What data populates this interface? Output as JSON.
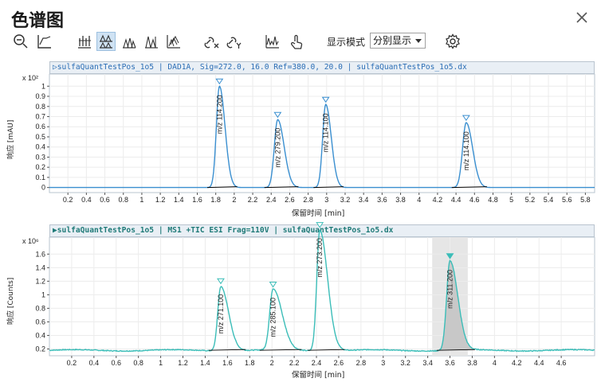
{
  "window": {
    "title": "色谱图"
  },
  "toolbar": {
    "icons": [
      "zoom-icon",
      "baseline-icon",
      "overlay-icon",
      "stack-icon",
      "separate-icon",
      "lines-icon",
      "stair-icon",
      "link-x-icon",
      "link-y-icon",
      "peaks-icon",
      "touch-icon"
    ],
    "mode_label": "显示模式",
    "mode_value": "分别显示",
    "settings_icon": "gear-icon"
  },
  "chart_data": [
    {
      "type": "line",
      "header": "▷sulfaQuantTestPos_1o5 | DAD1A, Sig=272.0, 16.0 Ref=380.0, 20.0 | sulfaQuantTestPos_1o5.dx",
      "ylabel": "响应 [mAU]",
      "xlabel": "保留时间 [min]",
      "y_multiplier": "x 10²",
      "xlim": [
        0,
        5.9
      ],
      "ylim": [
        -0.05,
        1.12
      ],
      "xticks": [
        0.2,
        0.4,
        0.6,
        0.8,
        1,
        1.2,
        1.4,
        1.6,
        1.8,
        2,
        2.2,
        2.4,
        2.6,
        2.8,
        3,
        3.2,
        3.4,
        3.6,
        3.8,
        4,
        4.2,
        4.4,
        4.6,
        4.8,
        5,
        5.2,
        5.4,
        5.6,
        5.8
      ],
      "xtick_labels": [
        "0.2",
        "0.4",
        "0.6",
        "0.8",
        "1",
        "1.2",
        "1.4",
        "1.6",
        "1.8",
        "2",
        "2.2",
        "2.4",
        "2.6",
        "2.8",
        "3",
        "3.2",
        "3.4",
        "3.6",
        "3.8",
        "4",
        "4.2",
        "4.4",
        "4.6",
        "4.8",
        "5",
        "5.2",
        "5.4",
        "5.6",
        "5.8"
      ],
      "yticks": [
        0,
        0.1,
        0.2,
        0.3,
        0.4,
        0.5,
        0.6,
        0.7,
        0.8,
        0.9,
        1
      ],
      "ytick_labels": [
        "0",
        "0.1",
        "0.2",
        "0.3",
        "0.4",
        "0.5",
        "0.6",
        "0.7",
        "0.8",
        "0.9",
        "1"
      ],
      "line_color": "#3a8fd0",
      "peaks": [
        {
          "label": "m/z 114.200",
          "rt": 1.84,
          "height": 1.0,
          "width": 0.055,
          "tail": 0.06
        },
        {
          "label": "m/z 279.200",
          "rt": 2.47,
          "height": 0.67,
          "width": 0.06,
          "tail": 0.07
        },
        {
          "label": "m/z 114.100",
          "rt": 2.99,
          "height": 0.82,
          "width": 0.055,
          "tail": 0.06
        },
        {
          "label": "m/z 114.100",
          "rt": 4.51,
          "height": 0.64,
          "width": 0.065,
          "tail": 0.07
        }
      ]
    },
    {
      "type": "line",
      "header": "▶sulfaQuantTestPos_1o5 | MS1 +TIC ESI Frag=110V | sulfaQuantTestPos_1o5.dx",
      "ylabel": "响应 [Counts]",
      "xlabel": "保留时间 [min]",
      "y_multiplier": "x 10⁶",
      "xlim": [
        0,
        4.9
      ],
      "ylim": [
        0.1,
        1.85
      ],
      "xticks": [
        0.2,
        0.4,
        0.6,
        0.8,
        1,
        1.2,
        1.4,
        1.6,
        1.8,
        2,
        2.2,
        2.4,
        2.6,
        2.8,
        3,
        3.2,
        3.4,
        3.6,
        3.8,
        4,
        4.2,
        4.4,
        4.6
      ],
      "xtick_labels": [
        "0.2",
        "0.4",
        "0.6",
        "0.8",
        "1",
        "1.2",
        "1.4",
        "1.6",
        "1.8",
        "2",
        "2.2",
        "2.4",
        "2.6",
        "2.8",
        "3",
        "3.2",
        "3.4",
        "3.6",
        "3.8",
        "4",
        "4.2",
        "4.4",
        "4.6"
      ],
      "yticks": [
        0.2,
        0.4,
        0.6,
        0.8,
        1,
        1.2,
        1.4,
        1.6
      ],
      "ytick_labels": [
        "0.2",
        "0.4",
        "0.6",
        "0.8",
        "1",
        "1.2",
        "1.4",
        "1.6"
      ],
      "line_color": "#3bbdb8",
      "baseline": 0.18,
      "highlight_range": [
        3.44,
        3.76
      ],
      "peaks": [
        {
          "label": "m/z 271.100",
          "rt": 1.54,
          "height": 0.95,
          "width": 0.045,
          "tail": 0.07,
          "filled": false
        },
        {
          "label": "m/z 285.100",
          "rt": 2.01,
          "height": 0.9,
          "width": 0.05,
          "tail": 0.08,
          "filled": false
        },
        {
          "label": "m/z 273.200",
          "rt": 2.43,
          "height": 1.78,
          "width": 0.045,
          "tail": 0.07,
          "filled": false
        },
        {
          "label": "m/z 311.200",
          "rt": 3.6,
          "height": 1.32,
          "width": 0.05,
          "tail": 0.07,
          "filled": true
        }
      ]
    }
  ]
}
